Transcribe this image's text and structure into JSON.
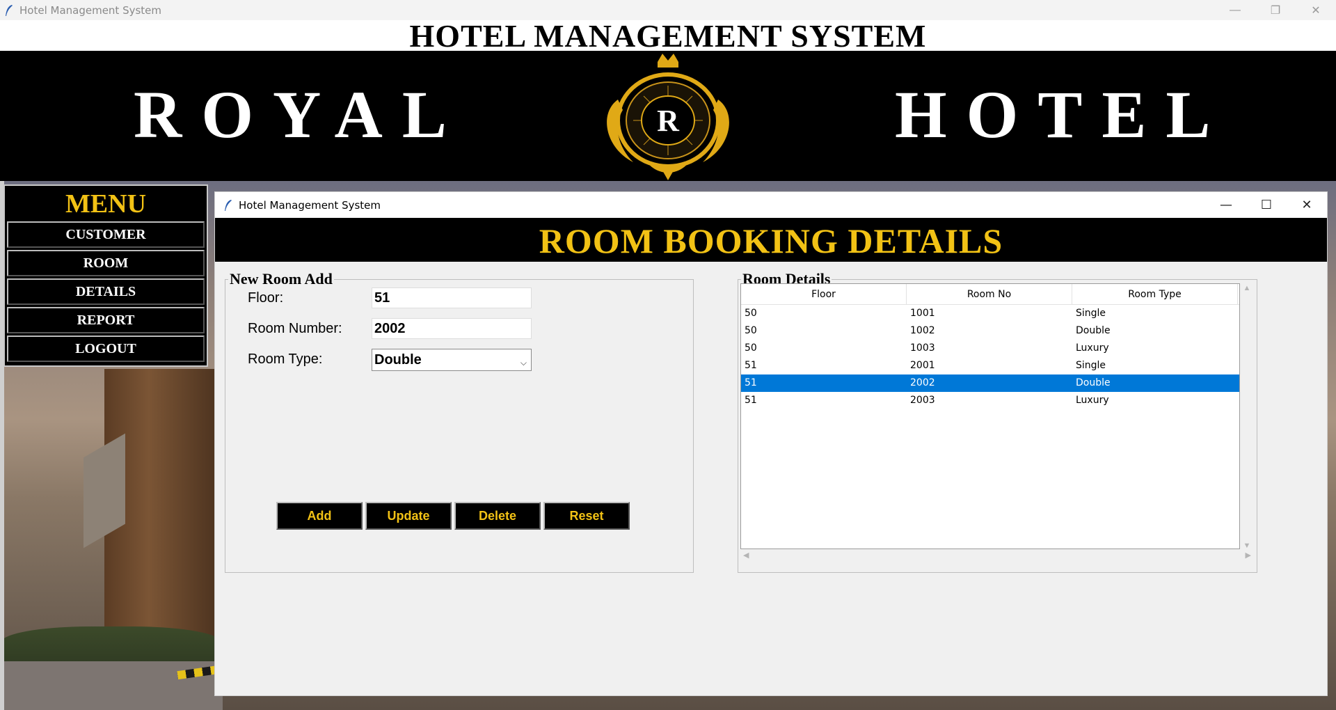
{
  "main_window": {
    "title": "Hotel Management System"
  },
  "banner": {
    "title": "HOTEL MANAGEMENT SYSTEM",
    "word_left": "ROYAL",
    "word_right": "HOTEL",
    "crest_letter": "R"
  },
  "menu": {
    "title": "MENU",
    "items": [
      {
        "label": "CUSTOMER"
      },
      {
        "label": "ROOM"
      },
      {
        "label": "DETAILS"
      },
      {
        "label": "REPORT"
      },
      {
        "label": "LOGOUT"
      }
    ]
  },
  "child_window": {
    "title": "Hotel Management System"
  },
  "room_booking": {
    "header": "ROOM BOOKING DETAILS",
    "form": {
      "legend": "New Room Add",
      "floor_label": "Floor:",
      "floor_value": "51",
      "room_number_label": "Room Number:",
      "room_number_value": "2002",
      "room_type_label": "Room Type:",
      "room_type_value": "Double"
    },
    "buttons": {
      "add": "Add",
      "update": "Update",
      "delete": "Delete",
      "reset": "Reset"
    },
    "details": {
      "legend": "Room Details",
      "columns": [
        "Floor",
        "Room No",
        "Room Type"
      ],
      "rows": [
        [
          "50",
          "1001",
          "Single"
        ],
        [
          "50",
          "1002",
          "Double"
        ],
        [
          "50",
          "1003",
          "Luxury"
        ],
        [
          "51",
          "2001",
          "Single"
        ],
        [
          "51",
          "2002",
          "Double"
        ],
        [
          "51",
          "2003",
          "Luxury"
        ]
      ],
      "selected_row": 4
    }
  },
  "colors": {
    "accent_gold": "#f2c215",
    "selection_blue": "#0078d7",
    "banner_black": "#000000"
  }
}
